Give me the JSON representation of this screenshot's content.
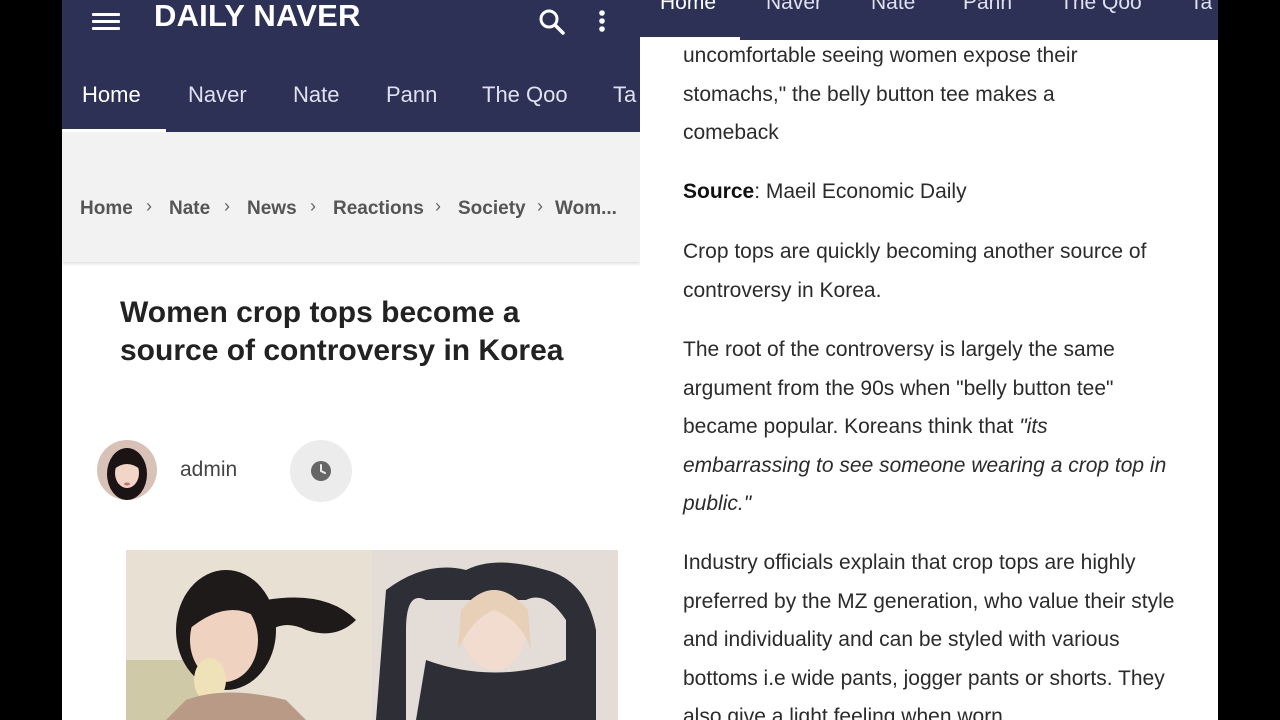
{
  "header": {
    "brand": "DAILY NAVER",
    "tabs": [
      "Home",
      "Naver",
      "Nate",
      "Pann",
      "The Qoo",
      "Ta"
    ]
  },
  "breadcrumb": [
    {
      "label": "Home"
    },
    {
      "label": "Nate"
    },
    {
      "label": "News"
    },
    {
      "label": "Reactions"
    },
    {
      "label": "Society"
    },
    {
      "label": "Wom..."
    }
  ],
  "breadcrumb_sep": "›",
  "article": {
    "title": "Women crop tops become a source of controversy in Korea",
    "author": "admin"
  },
  "right": {
    "tabs": [
      "Home",
      "Naver",
      "Nate",
      "Pann",
      "The Qoo",
      "Ta"
    ],
    "intro": "uncomfortable seeing women expose their stomachs,\" the belly button tee makes a comeback",
    "source_label": "Source",
    "source_value": ": Maeil Economic Daily",
    "p1": "Crop tops are quickly becoming another source of controversy in Korea.",
    "p2_text": "The root of the controversy is largely the same argument from the 90s when \"belly button tee\" became popular. Koreans think that ",
    "p2_quote": "\"its embarrassing to see someone wearing a crop top in public.\"",
    "p3": "Industry officials explain that crop tops are highly preferred by the MZ generation, who value their style and individuality and can be styled with various bottoms i.e wide pants, jogger pants or shorts. They also give a light feeling when worn"
  },
  "colors": {
    "navbar": "#2c3155",
    "crumb_bg": "#f2f2f2",
    "text": "#2b2b2b"
  },
  "icons": [
    "menu-icon",
    "search-icon",
    "more-vert-icon",
    "clock-icon"
  ]
}
